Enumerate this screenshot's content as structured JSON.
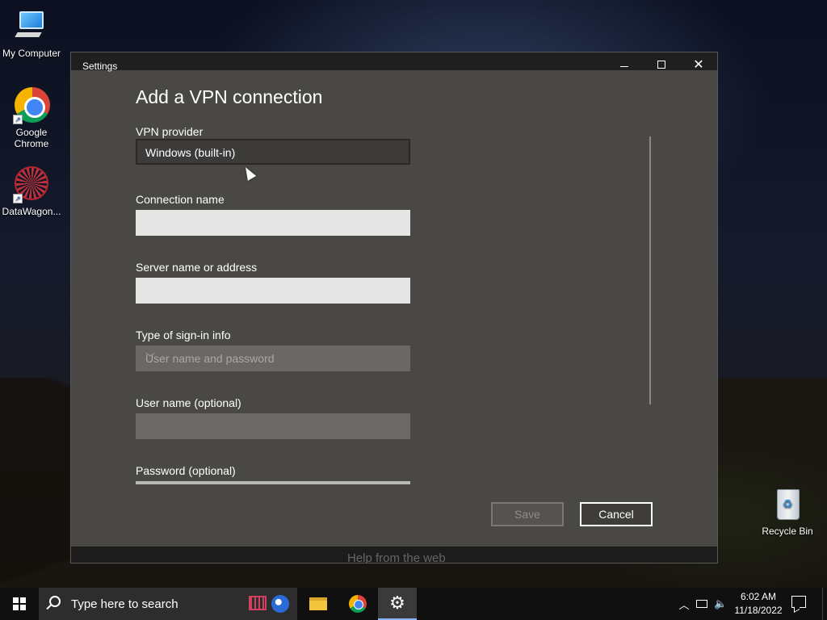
{
  "desktop": {
    "icons": [
      {
        "label": "My Computer",
        "icon": "computer-icon"
      },
      {
        "label": "Google Chrome",
        "icon": "chrome-icon"
      },
      {
        "label": "DataWagon...",
        "icon": "datawagon-icon"
      },
      {
        "label": "Recycle Bin",
        "icon": "recycle-bin-icon"
      }
    ]
  },
  "window": {
    "title": "Settings",
    "controls": {
      "minimize": "minimize-icon",
      "maximize": "maximize-icon",
      "close": "✕"
    },
    "bottom_text": "Help from the web"
  },
  "vpn_form": {
    "heading": "Add a VPN connection",
    "provider": {
      "label": "VPN provider",
      "value": "Windows (built-in)"
    },
    "connection_name": {
      "label": "Connection name",
      "value": ""
    },
    "server": {
      "label": "Server name or address",
      "value": ""
    },
    "signin_type": {
      "label": "Type of sign-in info",
      "value": "User name and password"
    },
    "username": {
      "label": "User name (optional)",
      "value": ""
    },
    "password": {
      "label": "Password (optional)",
      "value": ""
    },
    "save_label": "Save",
    "cancel_label": "Cancel"
  },
  "taskbar": {
    "search_placeholder": "Type here to search",
    "apps": [
      "file-explorer-icon",
      "chrome-icon",
      "settings-icon"
    ],
    "clock": {
      "time": "6:02 AM",
      "date": "11/18/2022"
    }
  }
}
